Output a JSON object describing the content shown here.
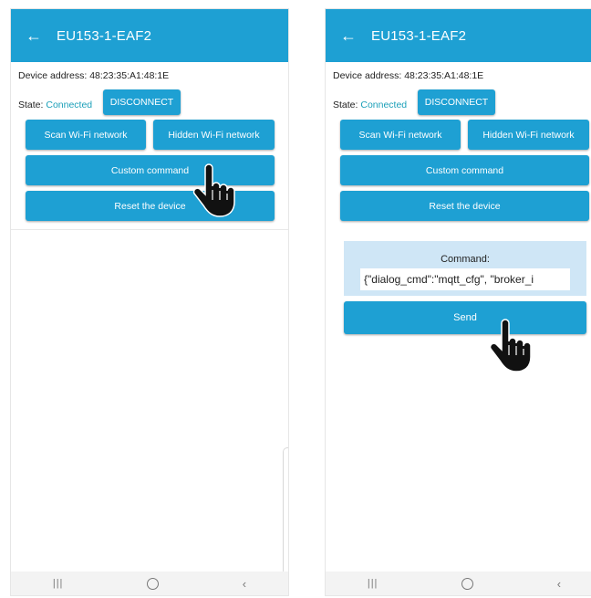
{
  "left": {
    "app_title": "EU153-1-EAF2",
    "device_address_label": "Device address: 48:23:35:A1:48:1E",
    "state_label": "State:",
    "state_value": "Connected",
    "disconnect_label": "DISCONNECT",
    "scan_label": "Scan Wi-Fi network",
    "hidden_label": "Hidden Wi-Fi network",
    "custom_label": "Custom command",
    "reset_label": "Reset the device"
  },
  "right": {
    "app_title": "EU153-1-EAF2",
    "device_address_label": "Device address: 48:23:35:A1:48:1E",
    "state_label": "State:",
    "state_value": "Connected",
    "disconnect_label": "DISCONNECT",
    "scan_label": "Scan Wi-Fi network",
    "hidden_label": "Hidden Wi-Fi network",
    "custom_label": "Custom command",
    "reset_label": "Reset the device",
    "command_label": "Command:",
    "command_value": "{\"dialog_cmd\":\"mqtt_cfg\", \"broker_i",
    "send_label": "Send"
  },
  "icons": {
    "back": "arrow-left-icon",
    "recent": "recent-apps-icon",
    "home": "home-icon",
    "nav_back": "chevron-left-icon",
    "pointer": "hand-pointer-icon"
  },
  "colors": {
    "appbar": "#1ea0d3",
    "button": "#1ea0d3",
    "state_connected": "#1a9fb8",
    "command_panel": "#cfe6f6"
  }
}
